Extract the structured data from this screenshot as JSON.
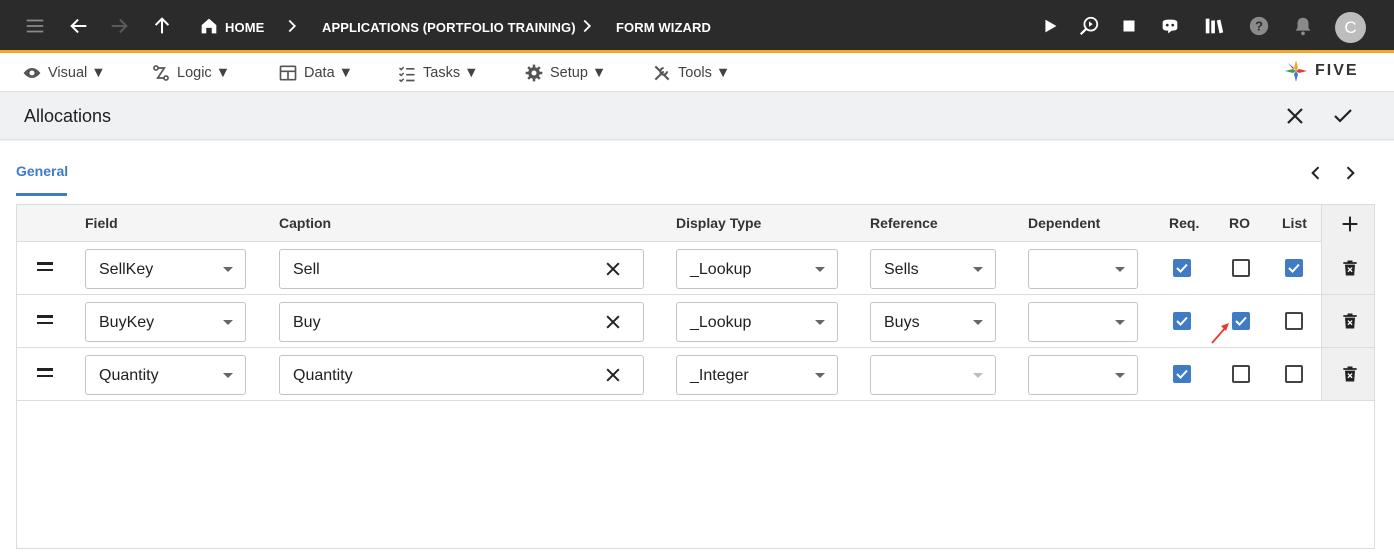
{
  "appbar": {
    "breadcrumbs": [
      "HOME",
      "APPLICATIONS (PORTFOLIO TRAINING)",
      "FORM WIZARD"
    ],
    "avatar_letter": "C",
    "icons": [
      "menu-icon",
      "back-arrow-icon",
      "forward-arrow-icon",
      "up-arrow-icon",
      "home-icon",
      "play-icon",
      "debug-search-icon",
      "stop-icon",
      "chat-bot-icon",
      "library-icon",
      "help-icon",
      "bell-icon"
    ]
  },
  "menubar": {
    "items": [
      {
        "label": "Visual ▼",
        "icon": "eye-icon"
      },
      {
        "label": "Logic ▼",
        "icon": "logic-flow-icon"
      },
      {
        "label": "Data ▼",
        "icon": "table-icon"
      },
      {
        "label": "Tasks ▼",
        "icon": "checklist-icon"
      },
      {
        "label": "Setup ▼",
        "icon": "gear-icon"
      },
      {
        "label": "Tools ▼",
        "icon": "tools-icon"
      }
    ],
    "logo_text": "FIVE"
  },
  "form": {
    "title": "Allocations",
    "tab": "General"
  },
  "grid": {
    "columns": [
      "Field",
      "Caption",
      "Display Type",
      "Reference",
      "Dependent",
      "Req.",
      "RO",
      "List"
    ],
    "rows": [
      {
        "field": "SellKey",
        "caption": "Sell",
        "display_type": "_Lookup",
        "reference": "Sells",
        "dependent": "",
        "req": true,
        "ro": false,
        "list": true
      },
      {
        "field": "BuyKey",
        "caption": "Buy",
        "display_type": "_Lookup",
        "reference": "Buys",
        "dependent": "",
        "req": true,
        "ro": true,
        "list": false
      },
      {
        "field": "Quantity",
        "caption": "Quantity",
        "display_type": "_Integer",
        "reference": "",
        "dependent": "",
        "req": true,
        "ro": false,
        "list": false
      }
    ]
  },
  "colors": {
    "accent": "#3f7cc4",
    "appbar": "#2b2b2b",
    "appbar_border": "#f5a623",
    "annotation": "#e53935"
  }
}
